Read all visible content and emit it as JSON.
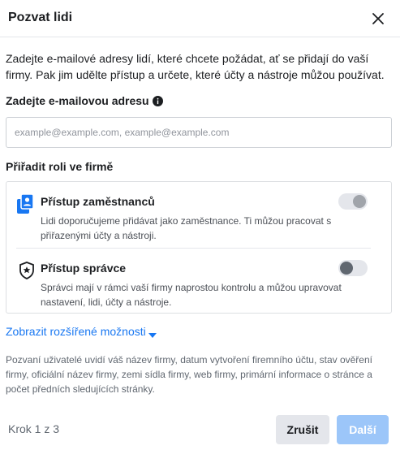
{
  "dialog": {
    "title": "Pozvat lidi",
    "intro": "Zadejte e-mailové adresy lidí, které chcete požádat, ať se přidají do vaší firmy. Pak jim udělte přístup a určete, které účty a nástroje můžou používat."
  },
  "email": {
    "label": "Zadejte e-mailovou adresu",
    "placeholder": "example@example.com, example@example.com",
    "value": ""
  },
  "roles": {
    "label": "Přiřadit roli ve firmě",
    "items": [
      {
        "name": "Přístup zaměstnanců",
        "description": "Lidi doporučujeme přidávat jako zaměstnance. Ti můžou pracovat s přiřazenými účty a nástroji.",
        "icon": "employee-badge-icon",
        "enabled": true,
        "disabled_control": true
      },
      {
        "name": "Přístup správce",
        "description": "Správci mají v rámci vaší firmy naprostou kontrolu a můžou upravovat nastavení, lidi, účty a nástroje.",
        "icon": "admin-shield-icon",
        "enabled": false,
        "disabled_control": false
      }
    ]
  },
  "advanced": {
    "label": "Zobrazit rozšířené možnosti"
  },
  "notice": "Pozvaní uživatelé uvidí váš název firmy, datum vytvoření firemního účtu, stav ověření firmy, oficiální název firmy, zemi sídla firmy, web firmy, primární informace o stránce a počet předních sledujících stránky.",
  "footer": {
    "step": "Krok 1 z 3",
    "cancel_label": "Zrušit",
    "next_label": "Další"
  },
  "colors": {
    "accent": "#1877f2",
    "next_disabled": "#9cc6f9",
    "employee_icon": "#1877f2"
  }
}
